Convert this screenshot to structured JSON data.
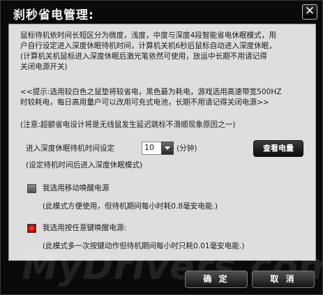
{
  "window": {
    "title": "刹秒省电管理:",
    "close_glyph": "✕"
  },
  "panel": {
    "intro_lines": [
      "鼠标待机依时间长短区分为微度，浅度，中度与深度4段智能省电休眠模式，用",
      "户自行设定进入深度休眠待机时间，计算机关机6秒后鼠标自动进入深度休眠，",
      "(计算机关机鼠标进入深度休眠后激光笔依然可使用，放运中长期不用请记得",
      "关闭电源开关)"
    ],
    "tip_lines": [
      "<<提示:选用较白色之鼠垫将较省电，黑色最为耗电，游戏选用高速带宽500HZ",
      "时较耗电，每日高用量户可以改用可充式电池，长期不用请记得关闭电源>>"
    ],
    "note": "(注意:超额省电设计将是无线鼠发生延迟跳标不滑顺现象原因之一)",
    "sleep_setting": {
      "label": "进入深度休眠待机时间设定",
      "value": "10",
      "unit": "(分钟)",
      "hint": "(设定待机时间后进入深度休眠模式)"
    },
    "check_battery_button": "查看电量",
    "options": [
      {
        "label": "我选用移动唤醒电源",
        "desc": "(此模式方便使用，但待机期间每小时耗0.8毫安电能.)",
        "checked": false
      },
      {
        "label": "我选用按任意键唤醒电源:",
        "desc": "(此模式多一次按键动作但待机期间每小时只耗0.01毫安电能.)",
        "checked": true
      }
    ]
  },
  "footer": {
    "ok_label": "确 定",
    "cancel_label": "取 消"
  },
  "watermark": "MyDrivers.com"
}
